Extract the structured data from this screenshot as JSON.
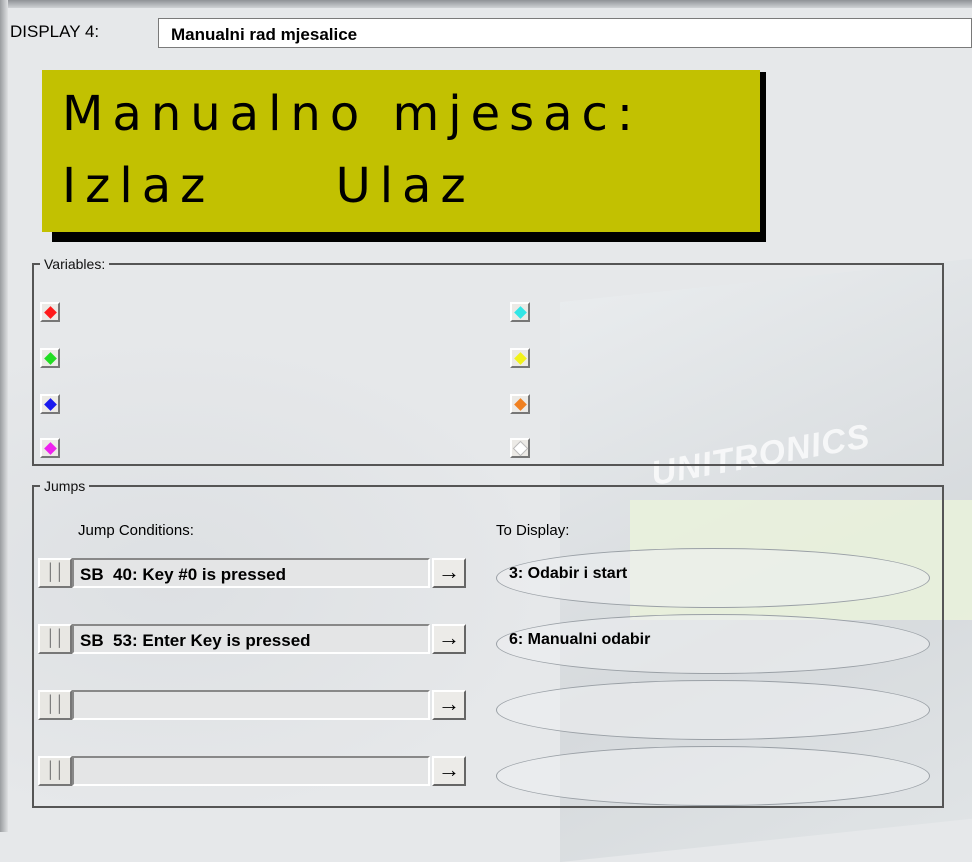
{
  "display": {
    "label": "DISPLAY 4:",
    "name": "Manualni rad mjesalice"
  },
  "lcd": {
    "line1": "Manualno mjesac:",
    "line2": "Izlaz     Ulaz",
    "background": "#c2c101"
  },
  "variables": {
    "legend": "Variables:",
    "left": [
      {
        "icon": "red-diamond-icon",
        "color": "#ff1a1a"
      },
      {
        "icon": "green-diamond-icon",
        "color": "#22dd22"
      },
      {
        "icon": "blue-diamond-icon",
        "color": "#1a1aee"
      },
      {
        "icon": "magenta-diamond-icon",
        "color": "#ee22ee"
      }
    ],
    "right": [
      {
        "icon": "cyan-diamond-icon",
        "color": "#33e6e6"
      },
      {
        "icon": "yellow-diamond-icon",
        "color": "#f2f21a"
      },
      {
        "icon": "orange-diamond-icon",
        "color": "#f08020"
      },
      {
        "icon": "white-diamond-icon",
        "color": "#ffffff"
      }
    ]
  },
  "jumps": {
    "legend": "Jumps",
    "conditions_header": "Jump Conditions:",
    "to_display_header": "To Display:",
    "rows": [
      {
        "contact": "││",
        "condition": "SB  40: Key #0 is pressed",
        "arrow": "→",
        "target": "3: Odabir i start"
      },
      {
        "contact": "││",
        "condition": "SB  53: Enter Key is pressed",
        "arrow": "→",
        "target": "6: Manualni odabir"
      },
      {
        "contact": "││",
        "condition": "",
        "arrow": "→",
        "target": ""
      },
      {
        "contact": "││",
        "condition": "",
        "arrow": "→",
        "target": ""
      }
    ]
  },
  "background": {
    "brand": "UNITRONICS"
  }
}
